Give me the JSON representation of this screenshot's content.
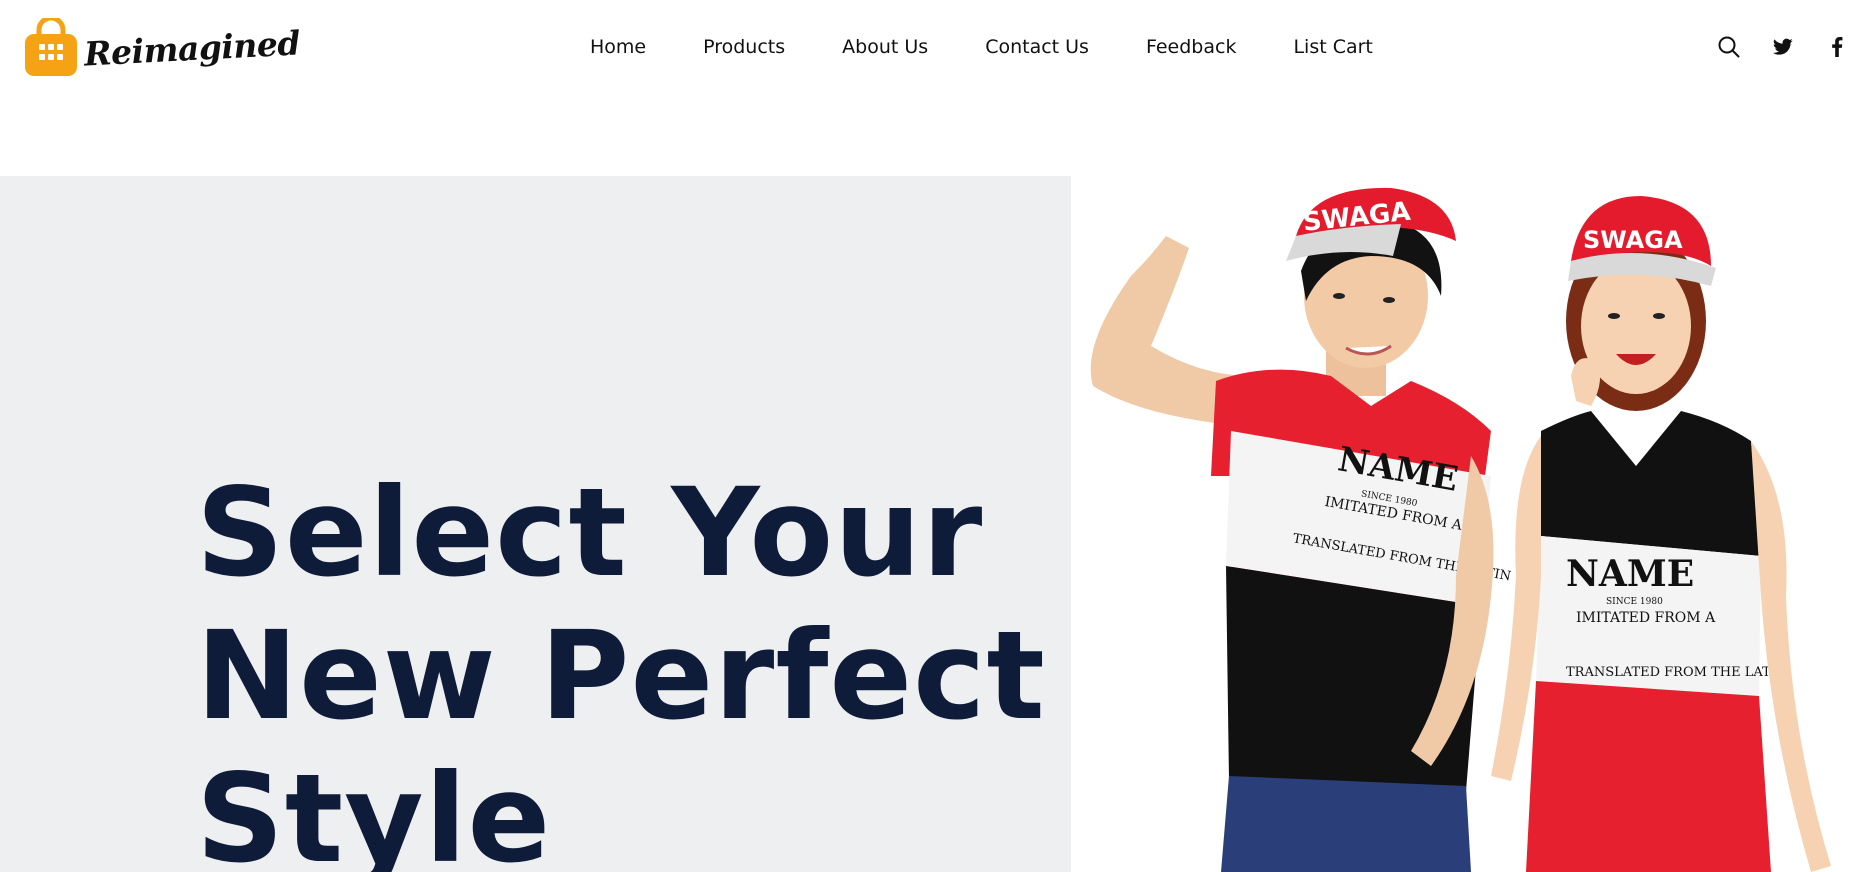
{
  "brand": {
    "name": "Reimagined",
    "color": "#f5a315"
  },
  "nav": {
    "items": [
      {
        "label": "Home"
      },
      {
        "label": "Products"
      },
      {
        "label": "About Us"
      },
      {
        "label": "Contact Us"
      },
      {
        "label": "Feedback"
      },
      {
        "label": "List Cart"
      }
    ]
  },
  "header_icons": [
    {
      "icon": "search-icon"
    },
    {
      "icon": "twitter-icon"
    },
    {
      "icon": "facebook-icon"
    }
  ],
  "hero": {
    "title_lines": [
      "Select Your",
      "New Perfect",
      "Style"
    ],
    "title_color": "#0e1c3a",
    "panel_color": "#eeeff1",
    "image": {
      "description_icon": "models-photo",
      "shirt_text_left": {
        "name": "NAME",
        "since": "SINCE 1980",
        "line": "IMITATED FROM A",
        "footer": "TRANSLATED FROM THE LATIN"
      },
      "shirt_text_right": {
        "name": "NAME",
        "since": "SINCE 1980",
        "line": "IMITATED FROM A",
        "footer": "TRANSLATED FROM THE LATIN"
      },
      "cap_text": "SWAGA"
    }
  }
}
